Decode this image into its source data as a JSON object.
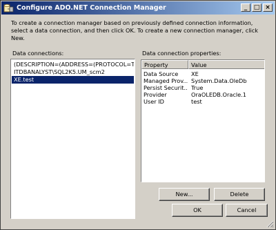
{
  "window": {
    "title": "Configure ADO.NET Connection Manager",
    "controls": {
      "minimize": "_",
      "maximize": "□",
      "close": "×"
    }
  },
  "intro_text": "To create a connection manager based on previously defined connection information, select a data connection, and then click OK. To create a new connection manager, click New.",
  "data_connections": {
    "label": "Data connections:",
    "items": [
      {
        "label": "(DESCRIPTION=(ADDRESS=(PROTOCOL=TC",
        "selected": false
      },
      {
        "label": "ITDBANALYST\\SQL2K5.UM_scm2",
        "selected": false
      },
      {
        "label": "XE.test",
        "selected": true
      }
    ]
  },
  "properties": {
    "label": "Data connection properties:",
    "columns": [
      "Property",
      "Value"
    ],
    "rows": [
      {
        "name": "Data Source",
        "value": "XE"
      },
      {
        "name": "Managed Prov...",
        "value": "System.Data.OleDb"
      },
      {
        "name": "Persist Securit...",
        "value": "True"
      },
      {
        "name": "Provider",
        "value": "OraOLEDB.Oracle.1"
      },
      {
        "name": "User ID",
        "value": "test"
      }
    ]
  },
  "buttons": {
    "new": "New...",
    "delete": "Delete",
    "ok": "OK",
    "cancel": "Cancel"
  },
  "colors": {
    "titlebar_start": "#0a246a",
    "titlebar_end": "#a6caf0",
    "selection": "#0a246a",
    "dialog_bg": "#d4d0c8"
  },
  "icons": {
    "app": "ssis-connection-icon"
  }
}
